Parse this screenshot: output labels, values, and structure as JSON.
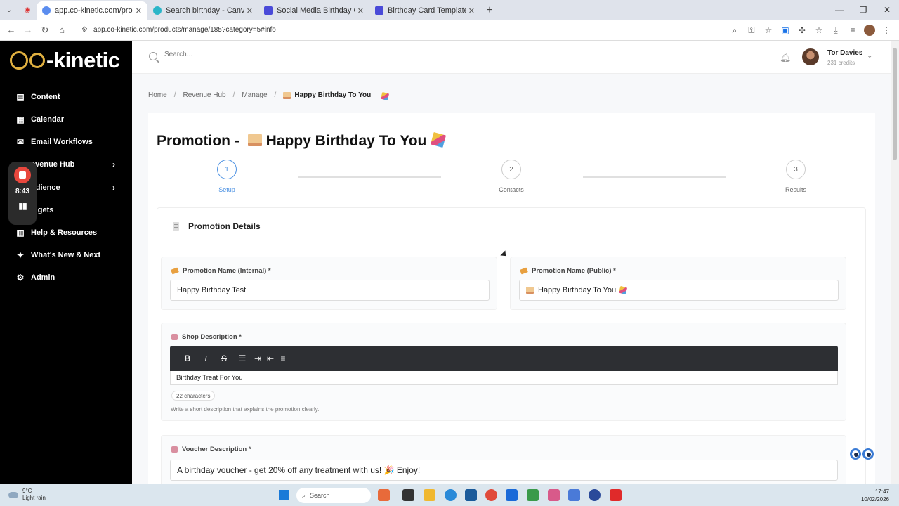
{
  "browser": {
    "tabs": [
      {
        "title": "app.co-kinetic.com/products/m",
        "active": true,
        "color": "#5b8def"
      },
      {
        "title": "Search birthday - Canva",
        "active": false,
        "color": "#2ab5c8"
      },
      {
        "title": "Social Media Birthday Card Tem",
        "active": false,
        "color": "#4a4ad8"
      },
      {
        "title": "Birthday Card Template for Co-",
        "active": false,
        "color": "#4a4ad8"
      }
    ],
    "url": "app.co-kinetic.com/products/manage/185?category=5#info"
  },
  "sidebar": {
    "logo": "-kinetic",
    "items": [
      {
        "label": "Content",
        "icon": "clipboard-icon"
      },
      {
        "label": "Calendar",
        "icon": "calendar-icon"
      },
      {
        "label": "Email Workflows",
        "icon": "mail-icon"
      },
      {
        "label": "evenue Hub",
        "icon": "currency-icon",
        "chevron": true
      },
      {
        "label": "udience",
        "icon": "users-icon",
        "chevron": true
      },
      {
        "label": "idgets",
        "icon": "widget-icon"
      },
      {
        "label": "Help & Resources",
        "icon": "book-icon"
      },
      {
        "label": "What's New & Next",
        "icon": "sparkle-icon"
      },
      {
        "label": "Admin",
        "icon": "gear-icon"
      }
    ],
    "recorder_time": "8:43"
  },
  "topbar": {
    "search_placeholder": "Search...",
    "user_name": "Tor Davies",
    "user_credits": "231 credits"
  },
  "breadcrumb": {
    "home": "Home",
    "revenue_hub": "Revenue Hub",
    "manage": "Manage",
    "current": "Happy Birthday To You"
  },
  "page": {
    "title_prefix": "Promotion -",
    "title_main": "Happy Birthday To You"
  },
  "stepper": {
    "steps": [
      {
        "number": "1",
        "label": "Setup",
        "active": true
      },
      {
        "number": "2",
        "label": "Contacts",
        "active": false
      },
      {
        "number": "3",
        "label": "Results",
        "active": false
      }
    ]
  },
  "details": {
    "section_title": "Promotion Details",
    "internal_label": "Promotion Name (Internal) *",
    "internal_value": "Happy Birthday Test",
    "public_label": "Promotion Name (Public) *",
    "public_value": "Happy Birthday To You",
    "shop_label": "Shop Description *",
    "shop_value": "Birthday Treat For You",
    "shop_chars": "22 characters",
    "shop_hint": "Write a short description that explains the promotion clearly.",
    "voucher_label": "Voucher Description *",
    "voucher_value": "A birthday voucher - get 20% off any treatment with us! 🎉 Enjoy!"
  },
  "taskbar": {
    "weather_temp": "9°C",
    "weather_desc": "Light rain",
    "search": "Search",
    "time": "17:47",
    "date": "10/02/2026"
  },
  "colors": {
    "accent": "#4a90e2",
    "sidebar_bg": "#000000",
    "toolbar_bg": "#2d2f33"
  }
}
